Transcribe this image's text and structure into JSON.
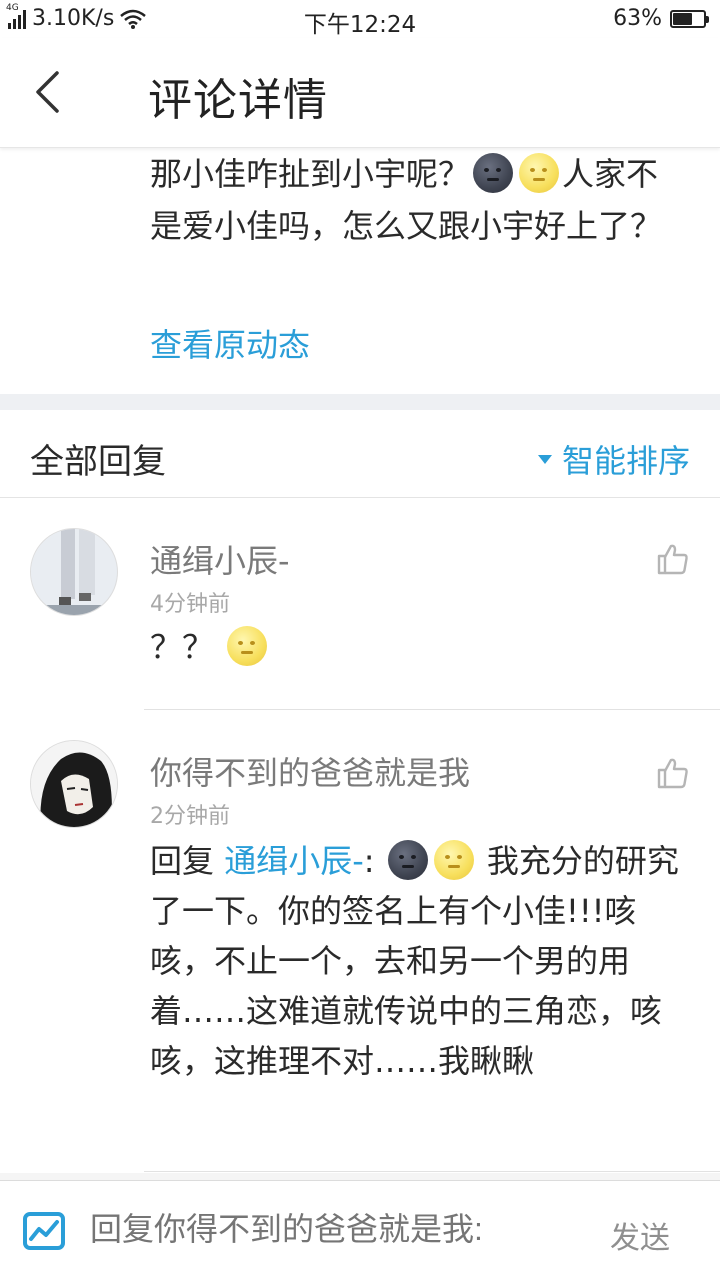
{
  "status_bar": {
    "network_type": "4G",
    "speed": "3.10K/s",
    "time": "下午12:24",
    "battery_text": "63%",
    "battery_level": 0.63
  },
  "header": {
    "title": "评论详情",
    "back_icon": "chevron-left-icon"
  },
  "post": {
    "text_part1": "那小佳咋扯到小宇呢？",
    "text_part2": "人家不是爱小佳吗，怎么又跟小宇好上了？",
    "emojis": [
      "new-moon-face-emoji",
      "full-moon-face-emoji"
    ],
    "view_original_label": "查看原动态"
  },
  "replies": {
    "title": "全部回复",
    "sort_label": "智能排序",
    "sort_icon": "caret-down-icon"
  },
  "comments": [
    {
      "username": "通缉小辰-",
      "time": "4分钟前",
      "text": "？？",
      "emojis": [
        "full-moon-face-emoji"
      ],
      "like_icon": "thumbs-up-icon"
    },
    {
      "username": "你得不到的爸爸就是我",
      "time": "2分钟前",
      "reply_prefix": "回复",
      "mention": "通缉小辰-",
      "mention_suffix": ":",
      "emojis": [
        "new-moon-face-emoji",
        "full-moon-face-emoji"
      ],
      "text": " 我充分的研究了一下。你的签名上有个小佳!!!咳咳，不止一个，去和另一个男的用着……这难道就传说中的三角恋，咳咳，这推理不对……我瞅瞅",
      "like_icon": "thumbs-up-icon"
    }
  ],
  "bottom_bar": {
    "placeholder": "回复你得不到的爸爸就是我:",
    "send_label": "发送",
    "icon": "reply-chart-icon"
  },
  "colors": {
    "accent": "#2a9ed8",
    "text": "#2a2a2a",
    "muted": "#7a7a7a",
    "divider": "#e2e2e2",
    "section_gap": "#eef0f3"
  }
}
